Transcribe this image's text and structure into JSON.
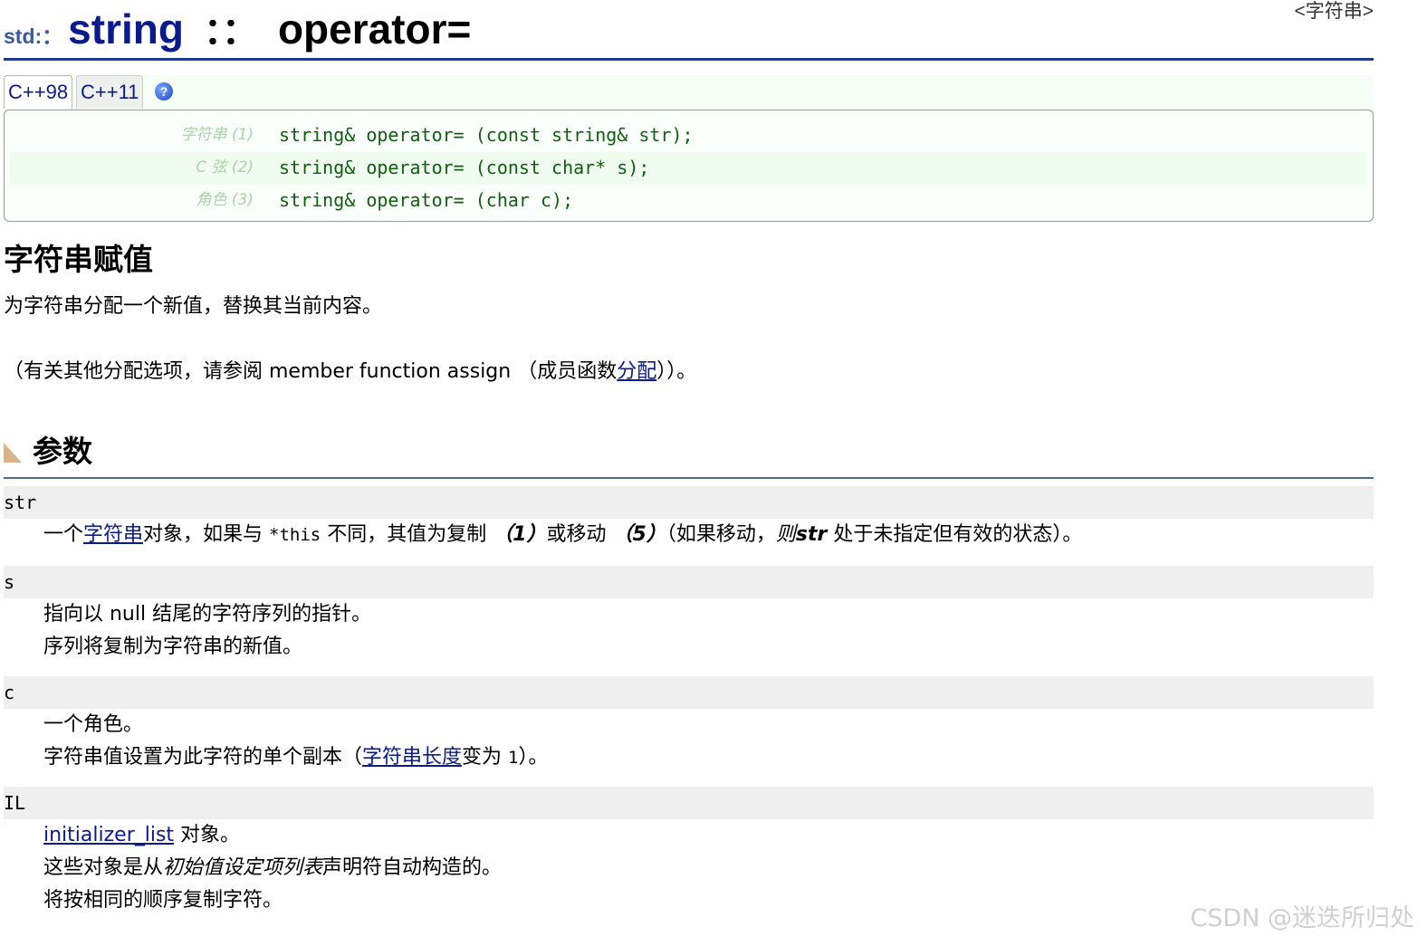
{
  "header": {
    "namespace": "std:：",
    "class_name": "string",
    "separator": "：：",
    "function_name": "operator=",
    "library": "<字符串>"
  },
  "version_tabs": [
    "C++98",
    "C++11"
  ],
  "help_icon_glyph": "?",
  "prototypes": [
    {
      "label": "字符串 (1)",
      "code": "string& operator= (const string& str);"
    },
    {
      "label": "C 弦 (2)",
      "code": "string& operator= (const char* s);"
    },
    {
      "label": "角色 (3)",
      "code": "string& operator= (char c);"
    }
  ],
  "description": {
    "heading": "字符串赋值",
    "p1": "为字符串分配一个新值，替换其当前内容。",
    "p2_before": "（有关其他分配选项，请参阅 member function assign （成员函数",
    "p2_link": "分配",
    "p2_after": "））。"
  },
  "parameters": {
    "heading": "参数",
    "items": [
      {
        "name": "str",
        "lines": [
          {
            "a": "一个",
            "link": "字符串",
            "b": "对象，如果与 ",
            "code": "*this",
            "c": " 不同，其值为复制 ",
            "d": "（1）",
            "e": "或移动 ",
            "f": "（5）",
            "g": "（如果移动，",
            "h": "则",
            "i": "str",
            "j": " 处于未指定但有效的状态）。"
          }
        ]
      },
      {
        "name": "s",
        "line1": "指向以 null 结尾的字符序列的指针。",
        "line2": "序列将复制为字符串的新值。"
      },
      {
        "name": "c",
        "line1": "一个角色。",
        "line2_a": "字符串值设置为此字符的单个副本（",
        "line2_link": "字符串长度",
        "line2_b": "变为 ",
        "line2_code": "1",
        "line2_c": "）。"
      },
      {
        "name": "IL",
        "line1_link": "initializer_list",
        "line1_b": " 对象。",
        "line2_a": "这些对象是从",
        "line2_it": "初始值设定项列表",
        "line2_b": "声明符自动构造的。",
        "line3": "将按相同的顺序复制字符。"
      }
    ]
  },
  "watermark": "CSDN @迷迭所归处"
}
